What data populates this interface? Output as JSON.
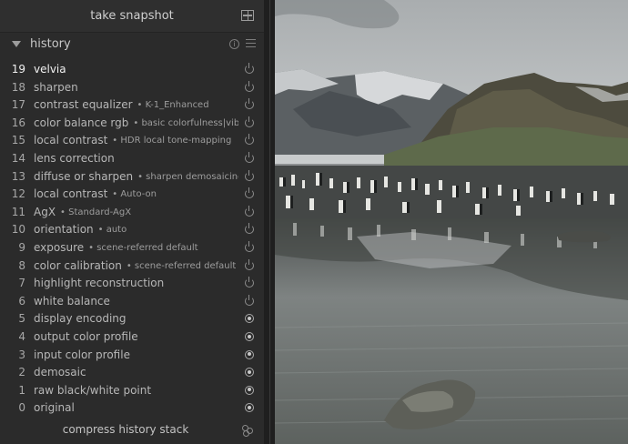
{
  "snapshot": {
    "label": "take snapshot",
    "icon": "snapshot-compare-icon"
  },
  "history": {
    "title": "history",
    "items": [
      {
        "num": "19",
        "name": "velvia",
        "detail": "",
        "state": "toggle",
        "selected": true
      },
      {
        "num": "18",
        "name": "sharpen",
        "detail": "",
        "state": "toggle"
      },
      {
        "num": "17",
        "name": "contrast equalizer",
        "detail": "• K-1_Enhanced",
        "state": "toggle"
      },
      {
        "num": "16",
        "name": "color balance rgb",
        "detail": "• basic colorfulness|vibra...",
        "state": "toggle"
      },
      {
        "num": "15",
        "name": "local contrast",
        "detail": "• HDR local tone-mapping",
        "state": "toggle"
      },
      {
        "num": "14",
        "name": "lens correction",
        "detail": "",
        "state": "toggle"
      },
      {
        "num": "13",
        "name": "diffuse or sharpen",
        "detail": "• sharpen demosaicing|n...",
        "state": "toggle"
      },
      {
        "num": "12",
        "name": "local contrast",
        "detail": "• Auto-on",
        "state": "toggle"
      },
      {
        "num": "11",
        "name": "AgX",
        "detail": "• Standard-AgX",
        "state": "toggle"
      },
      {
        "num": "10",
        "name": "orientation",
        "detail": "• auto",
        "state": "toggle"
      },
      {
        "num": "9",
        "name": "exposure",
        "detail": "• scene-referred default",
        "state": "toggle"
      },
      {
        "num": "8",
        "name": "color calibration",
        "detail": "• scene-referred default",
        "state": "toggle"
      },
      {
        "num": "7",
        "name": "highlight reconstruction",
        "detail": "",
        "state": "toggle"
      },
      {
        "num": "6",
        "name": "white balance",
        "detail": "",
        "state": "toggle"
      },
      {
        "num": "5",
        "name": "display encoding",
        "detail": "",
        "state": "always-on"
      },
      {
        "num": "4",
        "name": "output color profile",
        "detail": "",
        "state": "always-on"
      },
      {
        "num": "3",
        "name": "input color profile",
        "detail": "",
        "state": "always-on"
      },
      {
        "num": "2",
        "name": "demosaic",
        "detail": "",
        "state": "always-on"
      },
      {
        "num": "1",
        "name": "raw black/white point",
        "detail": "",
        "state": "always-on"
      },
      {
        "num": "0",
        "name": "original",
        "detail": "",
        "state": "always-on"
      }
    ]
  },
  "compress": {
    "label": "compress history stack"
  },
  "colors": {
    "panel_bg": "#2b2b2b",
    "text": "#b7b7b7",
    "selected_text": "#f0f0f0"
  }
}
